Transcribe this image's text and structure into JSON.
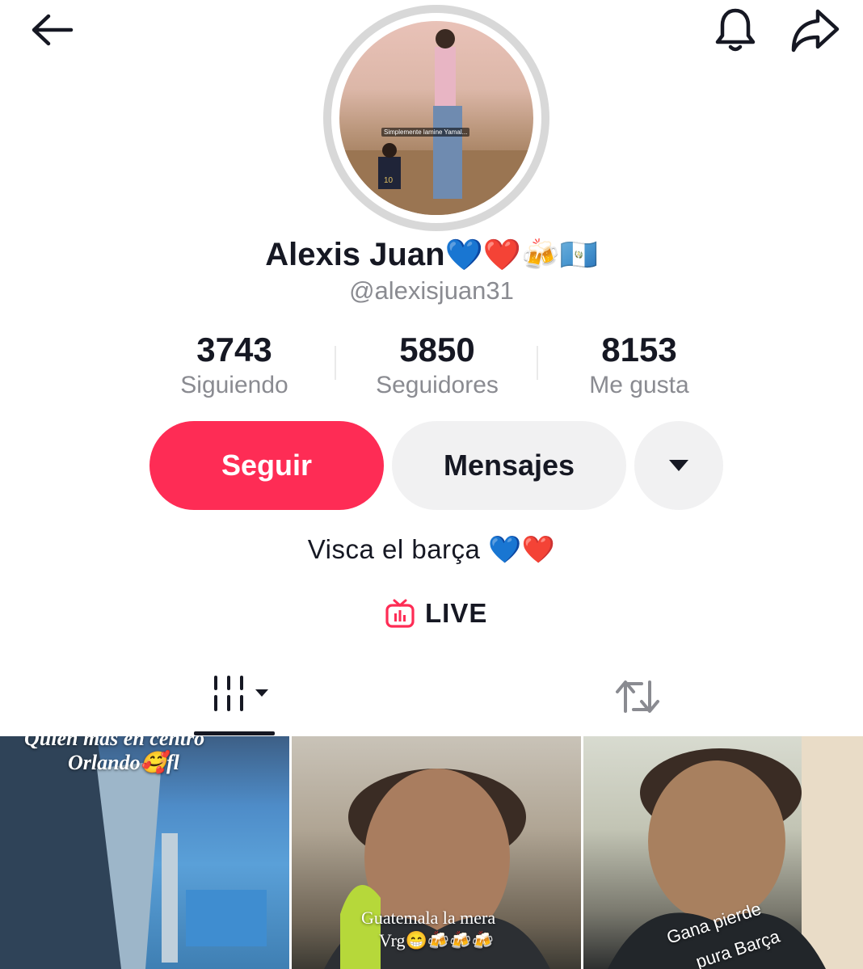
{
  "header": {
    "back_icon": "arrow-left-icon",
    "notifications_icon": "bell-icon",
    "share_icon": "share-icon"
  },
  "profile": {
    "avatar_caption": "Simplemente lamine Yamal...",
    "display_name": "Alexis Juan",
    "display_name_emojis": "💙❤️🍻🇬🇹",
    "username": "@alexisjuan31",
    "bio": "Visca el barça 💙❤️"
  },
  "stats": [
    {
      "value": "3743",
      "label": "Siguiendo"
    },
    {
      "value": "5850",
      "label": "Seguidores"
    },
    {
      "value": "8153",
      "label": "Me gusta"
    }
  ],
  "actions": {
    "follow_label": "Seguir",
    "message_label": "Mensajes",
    "more_icon": "caret-down-icon"
  },
  "live": {
    "label": "LIVE",
    "icon": "tv-live-icon"
  },
  "tabs": [
    {
      "name": "videos",
      "icon": "grid-icon",
      "selected": true
    },
    {
      "name": "reposts",
      "icon": "repost-icon",
      "selected": false
    }
  ],
  "thumbnails": [
    {
      "caption_line1": "Quien más en centro",
      "caption_line2": "Orlando🥰fl"
    },
    {
      "caption_line1": "Guatemala la mera",
      "caption_line2": "Vrg😁🍻🍻🍻"
    },
    {
      "caption_line1": "Gana pierde",
      "caption_line2": "pura Barça"
    }
  ],
  "colors": {
    "accent": "#fe2c55",
    "text_primary": "#161823",
    "text_secondary": "#8a8b91",
    "button_gray": "#f1f1f2"
  }
}
